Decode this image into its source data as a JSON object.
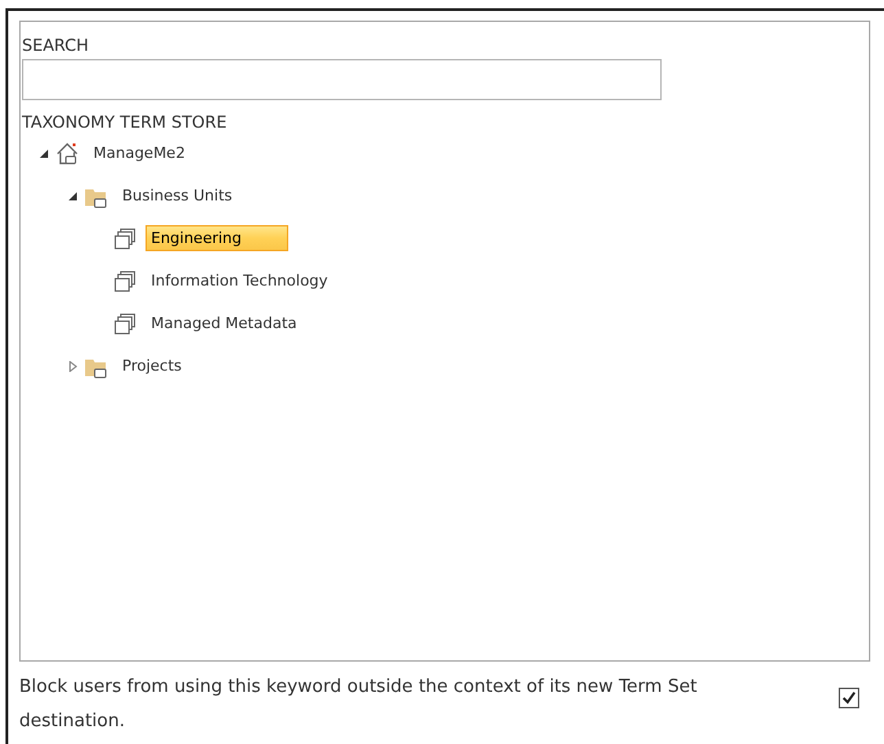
{
  "search": {
    "label": "SEARCH"
  },
  "tree": {
    "heading": "TAXONOMY TERM STORE",
    "items": [
      {
        "kind": "store",
        "label": "ManageMe2",
        "expanded": true,
        "selected": false,
        "children": [
          {
            "kind": "group",
            "label": "Business Units",
            "expanded": true,
            "selected": false,
            "children": [
              {
                "kind": "termset",
                "label": "Engineering",
                "selected": true
              },
              {
                "kind": "termset",
                "label": "Information Technology",
                "selected": false
              },
              {
                "kind": "termset",
                "label": "Managed Metadata",
                "selected": false
              }
            ]
          },
          {
            "kind": "group",
            "label": "Projects",
            "expanded": false,
            "selected": false
          }
        ]
      }
    ]
  },
  "option": {
    "label": "Block users from using this keyword outside the context of its new Term Set destination.",
    "checked": true
  }
}
